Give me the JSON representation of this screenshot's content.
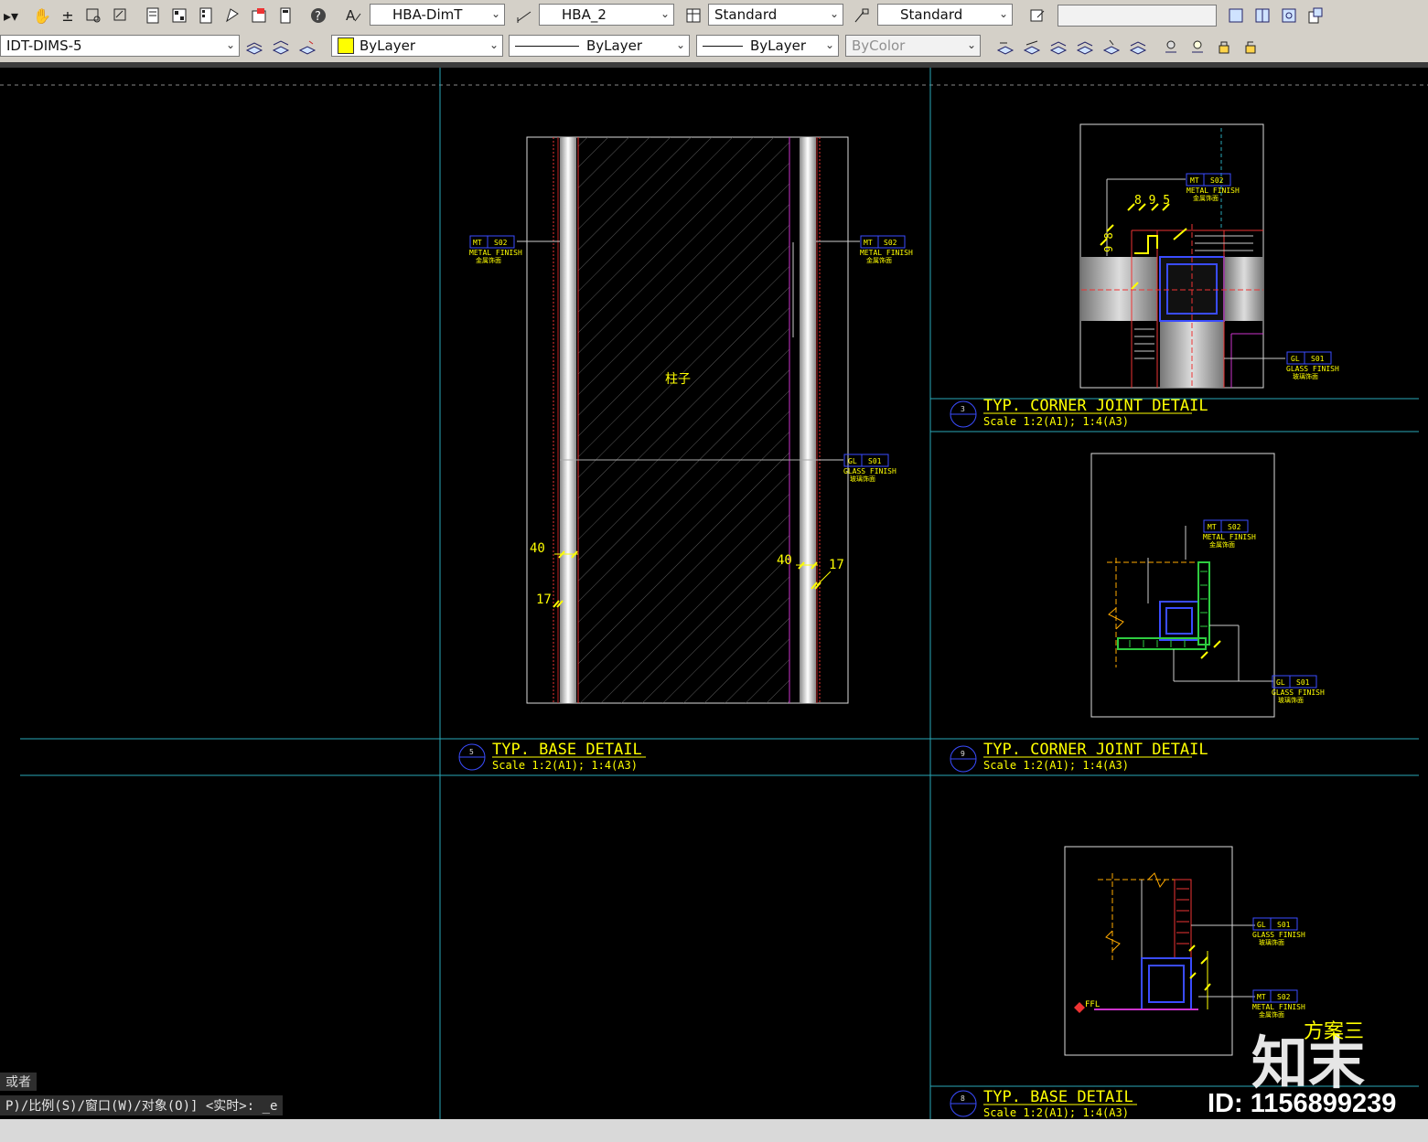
{
  "toolbar_top": {
    "dimstyle": "HBA-DimT",
    "multileader_style": "HBA_2",
    "table_style": "Standard",
    "multileader_style2": "Standard",
    "search_placeholder": ""
  },
  "toolbar_layers": {
    "layer": "IDT-DIMS-5",
    "color": "ByLayer",
    "linetype": "ByLayer",
    "lineweight": "ByLayer",
    "plotstyle": "ByColor"
  },
  "drawing": {
    "detail5": {
      "num": "5",
      "title": "TYP. BASE DETAIL",
      "scale": "Scale 1:2(A1); 1:4(A3)"
    },
    "detail3": {
      "num": "3",
      "title": "TYP. CORNER JOINT DETAIL",
      "scale": "Scale 1:2(A1); 1:4(A3)"
    },
    "detail9": {
      "num": "9",
      "title": "TYP. CORNER JOINT DETAIL",
      "scale": "Scale 1:2(A1); 1:4(A3)"
    },
    "detail8": {
      "num": "8",
      "title": "TYP. BASE DETAIL",
      "scale": "Scale 1:2(A1); 1:4(A3)"
    },
    "column_label": "柱子",
    "dims": {
      "d40a": "40",
      "d17a": "17",
      "d40b": "40",
      "d17b": "17",
      "d895": "8 9 5",
      "dvert": "9 8",
      "ffl": "FFL"
    },
    "tags": {
      "mt_code": "MT",
      "mt_num": "S02",
      "mt_en": "METAL FINISH",
      "mt_cn": "金属饰面",
      "gl_code": "GL",
      "gl_num": "S01",
      "gl_en": "GLASS FINISH",
      "gl_cn": "玻璃饰面"
    }
  },
  "command": {
    "prev": "或者",
    "line": "P)/比例(S)/窗口(W)/对象(O)] <实时>: _e"
  },
  "overlay": {
    "brand": "知末",
    "scheme": "方案三",
    "id": "ID: 1156899239"
  }
}
